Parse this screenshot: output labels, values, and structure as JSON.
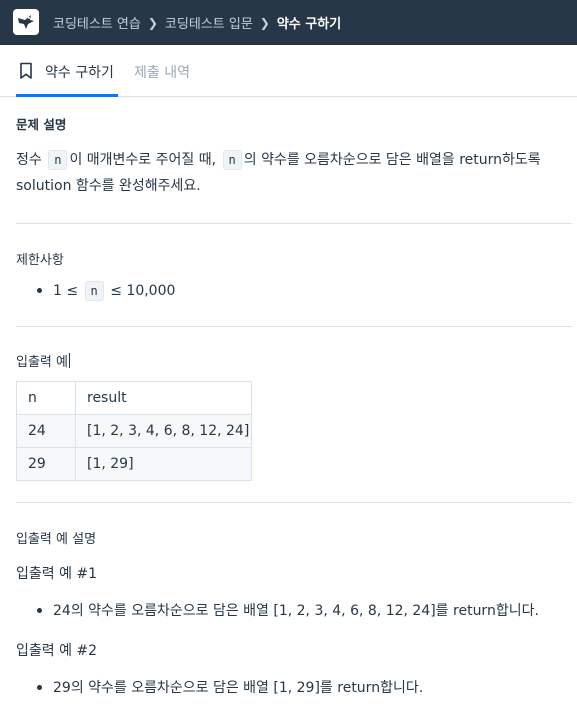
{
  "breadcrumb": {
    "items": [
      "코딩테스트 연습",
      "코딩테스트 입문"
    ],
    "current": "약수 구하기"
  },
  "tabs": {
    "problem": "약수 구하기",
    "submissions": "제출 내역"
  },
  "description": {
    "heading": "문제 설명",
    "part1": "정수",
    "var1": "n",
    "part2": "이 매개변수로 주어질 때,",
    "var2": "n",
    "part3": "의 약수를 오름차순으로 담은 배열을 return하도록",
    "line2": "solution 함수를 완성해주세요."
  },
  "constraints": {
    "heading": "제한사항",
    "pre": "1 ≤",
    "var": "n",
    "post": "≤ 10,000"
  },
  "io_example": {
    "heading": "입출력 예",
    "headers": [
      "n",
      "result"
    ],
    "rows": [
      [
        "24",
        "[1, 2, 3, 4, 6, 8, 12, 24]"
      ],
      [
        "29",
        "[1, 29]"
      ]
    ]
  },
  "io_explanation": {
    "heading": "입출력 예 설명",
    "ex1_title": "입출력 예 #1",
    "ex1_text": "24의 약수를 오름차순으로 담은 배열 [1, 2, 3, 4, 6, 8, 12, 24]를 return합니다.",
    "ex2_title": "입출력 예 #2",
    "ex2_text": "29의 약수를 오름차순으로 담은 배열 [1, 29]를 return합니다."
  },
  "colors": {
    "topbar": "#263747",
    "accent": "#0078ff",
    "text": "#263747",
    "muted": "#98a8b9"
  }
}
